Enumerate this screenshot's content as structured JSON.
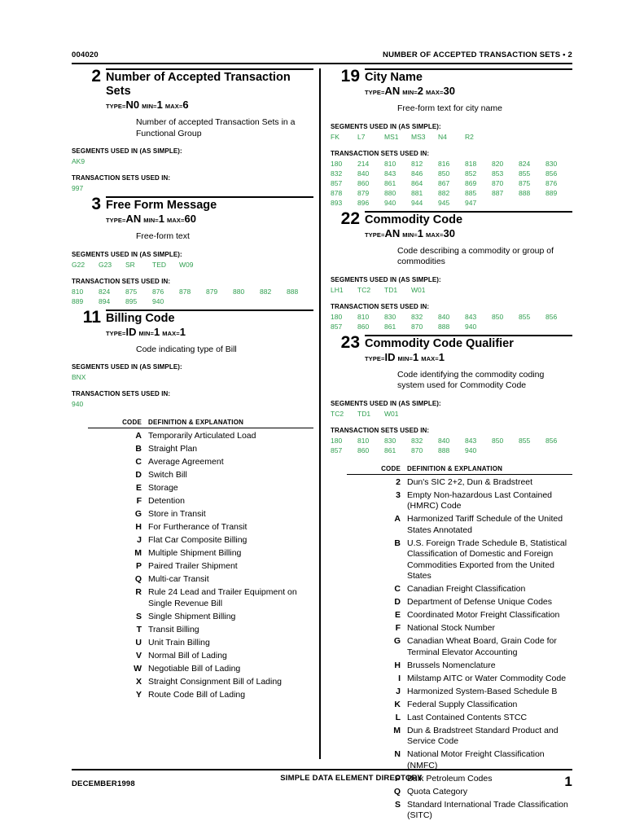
{
  "header": {
    "left": "004020",
    "right": "NUMBER OF ACCEPTED TRANSACTION SETS • 2"
  },
  "footer": {
    "left": "DECEMBER1998",
    "center": "SIMPLE DATA ELEMENT DIRECTORY",
    "page": "1"
  },
  "labels": {
    "type": "TYPE=",
    "min": "MIN=",
    "max": "MAX=",
    "segments_used": "SEGMENTS USED IN (AS SIMPLE):",
    "transaction_sets_used": "TRANSACTION SETS USED IN:",
    "code_header": "CODE",
    "definition_header": "DEFINITION & EXPLANATION"
  },
  "colors": {
    "code_green": "#2f9e4f",
    "rule": "#000000"
  },
  "left_column": [
    {
      "number": "2",
      "title": "Number of Accepted Transaction Sets",
      "type": "N0",
      "min": "1",
      "max": "6",
      "description": "Number of accepted Transaction Sets in a Functional Group",
      "segments": [
        "AK9"
      ],
      "transaction_sets": [
        "997"
      ]
    },
    {
      "number": "3",
      "title": "Free Form Message",
      "type": "AN",
      "min": "1",
      "max": "60",
      "description": "Free-form text",
      "segments": [
        "G22",
        "G23",
        "SR",
        "TED",
        "W09"
      ],
      "transaction_sets": [
        "810",
        "824",
        "875",
        "876",
        "878",
        "879",
        "880",
        "882",
        "888",
        "889",
        "894",
        "895",
        "940"
      ]
    },
    {
      "number": "11",
      "title": "Billing Code",
      "type": "ID",
      "min": "1",
      "max": "1",
      "description": "Code indicating type of Bill",
      "segments": [
        "BNX"
      ],
      "transaction_sets": [
        "940"
      ],
      "codes": [
        {
          "code": "A",
          "definition": "Temporarily Articulated Load"
        },
        {
          "code": "B",
          "definition": "Straight Plan"
        },
        {
          "code": "C",
          "definition": "Average Agreement"
        },
        {
          "code": "D",
          "definition": "Switch Bill"
        },
        {
          "code": "E",
          "definition": "Storage"
        },
        {
          "code": "F",
          "definition": "Detention"
        },
        {
          "code": "G",
          "definition": "Store in Transit"
        },
        {
          "code": "H",
          "definition": "For Furtherance of Transit"
        },
        {
          "code": "J",
          "definition": "Flat Car Composite Billing"
        },
        {
          "code": "M",
          "definition": "Multiple Shipment Billing"
        },
        {
          "code": "P",
          "definition": "Paired Trailer Shipment"
        },
        {
          "code": "Q",
          "definition": "Multi-car Transit"
        },
        {
          "code": "R",
          "definition": "Rule 24 Lead and Trailer Equipment on Single Revenue Bill"
        },
        {
          "code": "S",
          "definition": "Single Shipment Billing"
        },
        {
          "code": "T",
          "definition": "Transit Billing"
        },
        {
          "code": "U",
          "definition": "Unit Train Billing"
        },
        {
          "code": "V",
          "definition": "Normal Bill of Lading"
        },
        {
          "code": "W",
          "definition": "Negotiable Bill of Lading"
        },
        {
          "code": "X",
          "definition": "Straight Consignment Bill of Lading"
        },
        {
          "code": "Y",
          "definition": "Route Code Bill of Lading"
        }
      ]
    }
  ],
  "right_column": [
    {
      "number": "19",
      "title": "City Name",
      "type": "AN",
      "min": "2",
      "max": "30",
      "description": "Free-form text for city name",
      "segments": [
        "FK",
        "L7",
        "MS1",
        "MS3",
        "N4",
        "R2"
      ],
      "transaction_sets": [
        "180",
        "214",
        "810",
        "812",
        "816",
        "818",
        "820",
        "824",
        "830",
        "832",
        "840",
        "843",
        "846",
        "850",
        "852",
        "853",
        "855",
        "856",
        "857",
        "860",
        "861",
        "864",
        "867",
        "869",
        "870",
        "875",
        "876",
        "878",
        "879",
        "880",
        "881",
        "882",
        "885",
        "887",
        "888",
        "889",
        "893",
        "896",
        "940",
        "944",
        "945",
        "947"
      ]
    },
    {
      "number": "22",
      "title": "Commodity Code",
      "type": "AN",
      "min": "1",
      "max": "30",
      "description": "Code describing a commodity or group of commodities",
      "segments": [
        "LH1",
        "TC2",
        "TD1",
        "W01"
      ],
      "transaction_sets": [
        "180",
        "810",
        "830",
        "832",
        "840",
        "843",
        "850",
        "855",
        "856",
        "857",
        "860",
        "861",
        "870",
        "888",
        "940"
      ]
    },
    {
      "number": "23",
      "title": "Commodity Code Qualifier",
      "type": "ID",
      "min": "1",
      "max": "1",
      "description": "Code identifying the commodity coding system used for Commodity Code",
      "segments": [
        "TC2",
        "TD1",
        "W01"
      ],
      "transaction_sets": [
        "180",
        "810",
        "830",
        "832",
        "840",
        "843",
        "850",
        "855",
        "856",
        "857",
        "860",
        "861",
        "870",
        "888",
        "940"
      ],
      "codes": [
        {
          "code": "2",
          "definition": "Dun's SIC 2+2, Dun & Bradstreet"
        },
        {
          "code": "3",
          "definition": "Empty Non-hazardous Last Contained (HMRC) Code"
        },
        {
          "code": "A",
          "definition": "Harmonized Tariff Schedule of the United States Annotated"
        },
        {
          "code": "B",
          "definition": "U.S. Foreign Trade Schedule B, Statistical Classification of Domestic and Foreign Commodities Exported from the United States"
        },
        {
          "code": "C",
          "definition": "Canadian Freight Classification"
        },
        {
          "code": "D",
          "definition": "Department of Defense Unique Codes"
        },
        {
          "code": "E",
          "definition": "Coordinated Motor Freight Classification"
        },
        {
          "code": "F",
          "definition": "National Stock Number"
        },
        {
          "code": "G",
          "definition": "Canadian Wheat Board, Grain Code for Terminal Elevator Accounting"
        },
        {
          "code": "H",
          "definition": "Brussels Nomenclature"
        },
        {
          "code": "I",
          "definition": "Milstamp AITC or Water Commodity Code"
        },
        {
          "code": "J",
          "definition": "Harmonized System-Based Schedule B"
        },
        {
          "code": "K",
          "definition": "Federal Supply Classification"
        },
        {
          "code": "L",
          "definition": "Last Contained Contents STCC"
        },
        {
          "code": "M",
          "definition": "Dun & Bradstreet Standard Product and Service Code"
        },
        {
          "code": "N",
          "definition": "National Motor Freight Classification (NMFC)"
        },
        {
          "code": "P",
          "definition": "Bulk Petroleum Codes"
        },
        {
          "code": "Q",
          "definition": "Quota Category"
        },
        {
          "code": "S",
          "definition": "Standard International Trade Classification (SITC)"
        }
      ]
    }
  ]
}
